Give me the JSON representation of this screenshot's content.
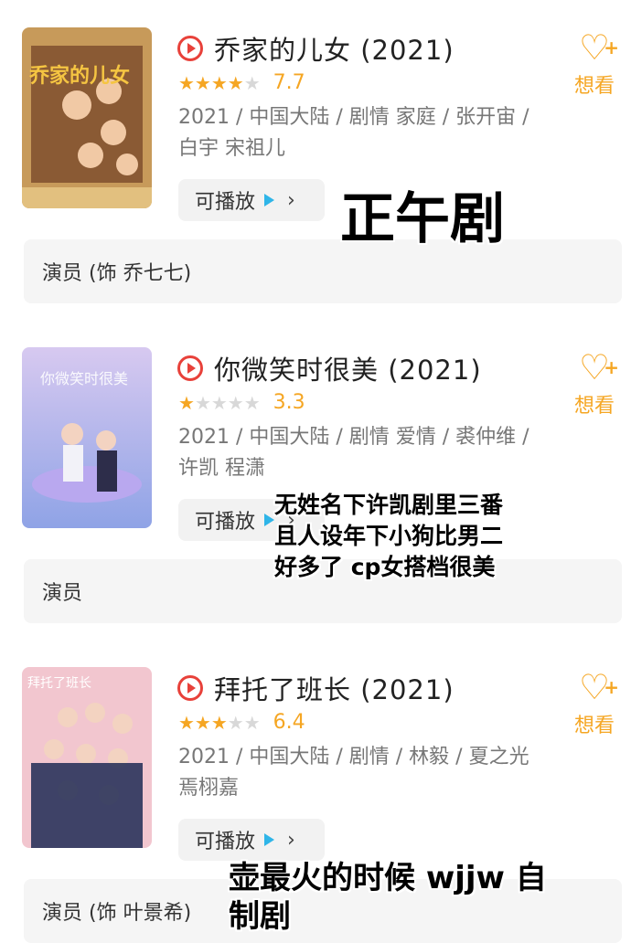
{
  "items": [
    {
      "title": "乔家的儿女 (2021)",
      "rating": 7.7,
      "stars_on": "★★★★",
      "stars_off": "★",
      "score": "7.7",
      "meta": "2021 / 中国大陆 / 剧情 家庭 / 张开宙 / 白宇 宋祖儿",
      "play_label": "可播放",
      "want_label": "想看",
      "cast": "演员 (饰 乔七七)",
      "poster_text": "乔家的儿女"
    },
    {
      "title": "你微笑时很美 (2021)",
      "rating": 3.3,
      "stars_on": "★",
      "stars_off": "★★★★",
      "score": "3.3",
      "meta": "2021 / 中国大陆 / 剧情 爱情 / 裘仲维 / 许凯 程潇",
      "play_label": "可播放",
      "want_label": "想看",
      "cast": "演员",
      "poster_text": "你微笑时很美"
    },
    {
      "title": "拜托了班长 (2021)",
      "rating": 6.4,
      "stars_on": "★★★",
      "stars_off": "★★",
      "score": "6.4",
      "meta": "2021 / 中国大陆 / 剧情 / 林毅 / 夏之光 焉栩嘉",
      "play_label": "可播放",
      "want_label": "想看",
      "cast": "演员 (饰 叶景希)",
      "poster_text": "拜托了班长"
    }
  ],
  "overlays": {
    "first": "正午剧",
    "second_line1": "无姓名下许凯剧里三番",
    "second_line2": "且人设年下小狗比男二",
    "second_line3": "好多了 cp女搭档很美",
    "third_line1": "壶最火的时候 wjjw 自",
    "third_line2": "制剧"
  },
  "colors": {
    "accent": "#f5a623",
    "play_icon": "#e8413a",
    "play_tri": "#2fb5e8"
  }
}
